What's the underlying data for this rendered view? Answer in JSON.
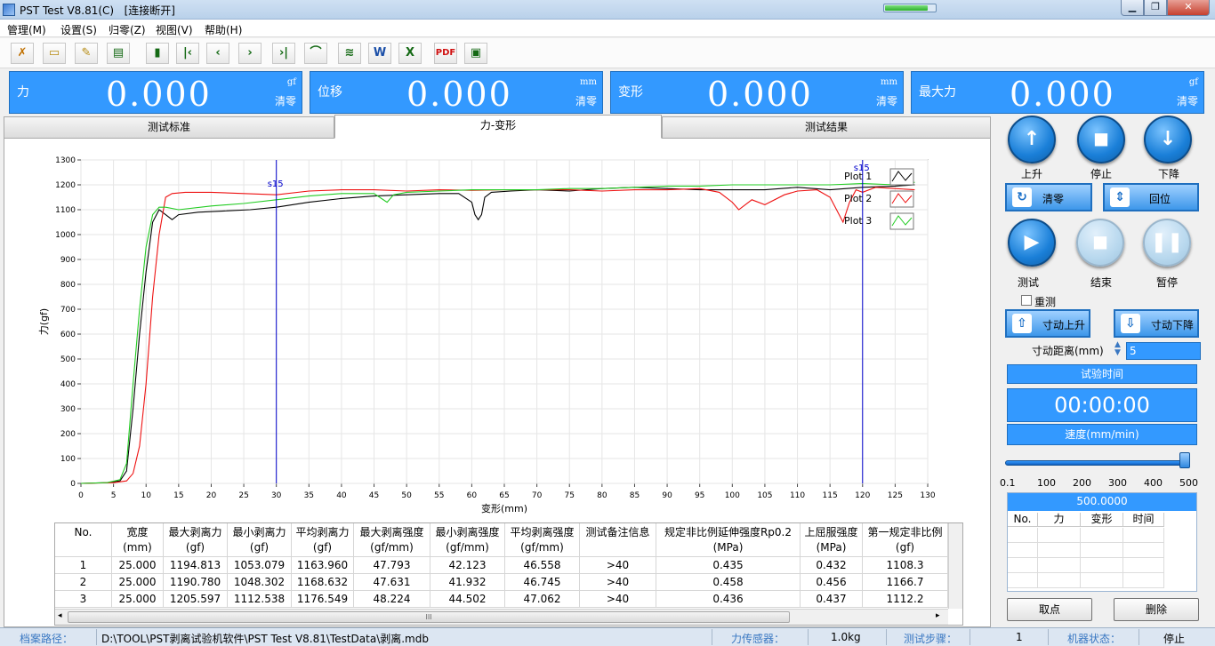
{
  "window": {
    "title": "PST Test V8.81(C)",
    "status": "[连接断开]",
    "progress": 0.85
  },
  "menu": [
    "管理(M)",
    "设置(S)",
    "归零(Z)",
    "视图(V)",
    "帮助(H)"
  ],
  "toolbar": {
    "icons": [
      "tools-icon",
      "open-folder-icon",
      "edit-report-icon",
      "export-icon",
      "save-icon",
      "first-icon",
      "prev-icon",
      "next-icon",
      "last-icon",
      "curve-icon",
      "multi-curve-icon",
      "word-icon",
      "excel-icon",
      "pdf-icon",
      "monitor-icon"
    ],
    "glyphs": [
      "✗",
      "▭",
      "✎",
      "▤",
      "▮",
      "|‹",
      "‹",
      "›",
      "›|",
      "⌒",
      "≋",
      "W",
      "X",
      "PDF",
      "▣"
    ]
  },
  "meters": [
    {
      "label": "力",
      "value": "0.000",
      "unit": "gf",
      "zero": "清零"
    },
    {
      "label": "位移",
      "value": "0.000",
      "unit": "mm",
      "zero": "清零"
    },
    {
      "label": "变形",
      "value": "0.000",
      "unit": "mm",
      "zero": "清零"
    },
    {
      "label": "最大力",
      "value": "0.000",
      "unit": "gf",
      "zero": "清零"
    }
  ],
  "tabs": [
    {
      "label": "测试标准",
      "active": false
    },
    {
      "label": "力-变形",
      "active": true
    },
    {
      "label": "测试结果",
      "active": false
    }
  ],
  "chart_data": {
    "type": "line",
    "xlabel": "变形(mm)",
    "ylabel": "力(gf)",
    "xlim": [
      0,
      130
    ],
    "ylim": [
      0,
      1300
    ],
    "xticks": [
      0,
      5,
      10,
      15,
      20,
      25,
      30,
      35,
      40,
      45,
      50,
      55,
      60,
      65,
      70,
      75,
      80,
      85,
      90,
      95,
      100,
      105,
      110,
      115,
      120,
      125,
      130
    ],
    "yticks": [
      0,
      100,
      200,
      300,
      400,
      500,
      600,
      700,
      800,
      900,
      1000,
      1100,
      1200,
      1300
    ],
    "cursors": [
      {
        "label": "s15",
        "x": 30
      },
      {
        "label": "s15",
        "x": 120
      }
    ],
    "legend_position": "top-right",
    "series": [
      {
        "name": "Plot 1",
        "color": "#000000",
        "x": [
          0,
          4,
          6,
          7,
          8,
          9,
          10,
          11,
          12,
          13,
          14,
          15,
          18,
          22,
          26,
          30,
          35,
          40,
          45,
          50,
          55,
          58,
          60,
          60.5,
          61,
          61.5,
          62,
          63,
          66,
          70,
          75,
          80,
          85,
          90,
          95,
          100,
          105,
          110,
          115,
          120,
          125,
          128
        ],
        "y": [
          0,
          3,
          10,
          50,
          300,
          600,
          850,
          1050,
          1100,
          1080,
          1060,
          1080,
          1090,
          1095,
          1100,
          1110,
          1130,
          1145,
          1155,
          1160,
          1165,
          1165,
          1130,
          1080,
          1060,
          1080,
          1150,
          1170,
          1175,
          1180,
          1175,
          1185,
          1190,
          1185,
          1180,
          1180,
          1180,
          1190,
          1180,
          1190,
          1195,
          1200
        ]
      },
      {
        "name": "Plot 2",
        "color": "#ee1111",
        "x": [
          0,
          5,
          7,
          8,
          9,
          10,
          11,
          12,
          13,
          14,
          16,
          20,
          25,
          30,
          35,
          40,
          45,
          50,
          55,
          60,
          65,
          70,
          75,
          80,
          85,
          90,
          95,
          98,
          100,
          101,
          103,
          105,
          108,
          110,
          113,
          115,
          116,
          117,
          118,
          119,
          120,
          122,
          125,
          128
        ],
        "y": [
          0,
          3,
          10,
          40,
          150,
          400,
          750,
          1000,
          1150,
          1165,
          1170,
          1170,
          1165,
          1160,
          1175,
          1180,
          1180,
          1175,
          1180,
          1178,
          1180,
          1180,
          1180,
          1175,
          1180,
          1180,
          1185,
          1170,
          1130,
          1100,
          1140,
          1120,
          1160,
          1175,
          1180,
          1150,
          1100,
          1050,
          1130,
          1180,
          1170,
          1190,
          1185,
          1180
        ]
      },
      {
        "name": "Plot 3",
        "color": "#22cc22",
        "x": [
          0,
          4,
          6,
          7,
          8,
          9,
          10,
          11,
          12,
          13,
          15,
          20,
          25,
          30,
          35,
          40,
          45,
          47,
          48,
          50,
          55,
          60,
          65,
          70,
          75,
          80,
          85,
          90,
          95,
          100,
          105,
          110,
          115,
          120,
          125,
          128
        ],
        "y": [
          0,
          3,
          15,
          80,
          400,
          700,
          950,
          1080,
          1110,
          1110,
          1100,
          1115,
          1125,
          1140,
          1155,
          1165,
          1165,
          1130,
          1160,
          1170,
          1175,
          1180,
          1180,
          1180,
          1185,
          1185,
          1190,
          1195,
          1195,
          1200,
          1200,
          1200,
          1200,
          1205,
          1200,
          1210
        ]
      }
    ]
  },
  "results_table": {
    "columns": [
      {
        "h1": "No.",
        "h2": ""
      },
      {
        "h1": "宽度",
        "h2": "(mm)"
      },
      {
        "h1": "最大剥离力",
        "h2": "(gf)"
      },
      {
        "h1": "最小剥离力",
        "h2": "(gf)"
      },
      {
        "h1": "平均剥离力",
        "h2": "(gf)"
      },
      {
        "h1": "最大剥离强度",
        "h2": "(gf/mm)"
      },
      {
        "h1": "最小剥离强度",
        "h2": "(gf/mm)"
      },
      {
        "h1": "平均剥离强度",
        "h2": "(gf/mm)"
      },
      {
        "h1": "测试备注信息",
        "h2": ""
      },
      {
        "h1": "规定非比例延伸强度Rp0.2",
        "h2": "(MPa)"
      },
      {
        "h1": "上屈服强度",
        "h2": "(MPa)"
      },
      {
        "h1": "第一规定非比例",
        "h2": "(gf)"
      }
    ],
    "rows": [
      [
        "1",
        "25.000",
        "1194.813",
        "1053.079",
        "1163.960",
        "47.793",
        "42.123",
        "46.558",
        ">40",
        "0.435",
        "0.432",
        "1108.3"
      ],
      [
        "2",
        "25.000",
        "1190.780",
        "1048.302",
        "1168.632",
        "47.631",
        "41.932",
        "46.745",
        ">40",
        "0.458",
        "0.456",
        "1166.7"
      ],
      [
        "3",
        "25.000",
        "1205.597",
        "1112.538",
        "1176.549",
        "48.224",
        "44.502",
        "47.062",
        ">40",
        "0.436",
        "0.437",
        "1112.2"
      ]
    ],
    "scroll_thumb": "III"
  },
  "controls": {
    "up": "上升",
    "stop": "停止",
    "down": "下降",
    "zero_btn": "清零",
    "return_btn": "回位",
    "test": "测试",
    "end": "结束",
    "pause": "暂停",
    "retest": "重测",
    "jog_up": "寸动上升",
    "jog_down": "寸动下降",
    "jog_distance_label": "寸动距离(mm)",
    "jog_distance": "5",
    "test_time_label": "试验时间",
    "test_time": "00:00:00",
    "speed_label": "速度(mm/min)",
    "speed_ticks": [
      "0.1",
      "100",
      "200",
      "300",
      "400",
      "500"
    ],
    "speed_value": "500.0000",
    "speed_fraction": 1.0,
    "mini_table_headers": [
      "No.",
      "力",
      "变形",
      "时间"
    ],
    "bottom_left": "取点",
    "bottom_right": "删除"
  },
  "statusbar": {
    "path_label": "档案路径：",
    "path": "D:\\TOOL\\PST剥离试验机软件\\PST Test V8.81\\TestData\\剥离.mdb",
    "sensor_label": "力传感器：",
    "sensor": "1.0kg",
    "step_label": "测试步骤：",
    "step": "1",
    "machine_label": "机器状态：",
    "machine": "停止"
  }
}
